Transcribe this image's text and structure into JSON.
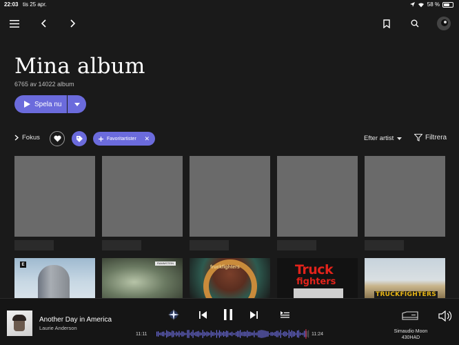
{
  "status": {
    "time": "22:03",
    "date": "tis 25 apr.",
    "battery": "58 %",
    "battery_level": 0.58
  },
  "header": {
    "title": "Mina album",
    "subtitle": "6765 av 14022 album"
  },
  "actions": {
    "play_label": "Spela nu"
  },
  "filters": {
    "focus_label": "Fokus",
    "chip_label": "Favoritartister",
    "sort_label": "Efter artist",
    "filter_label": "Filtrera"
  },
  "albums_row2": [
    {
      "badge": "E"
    },
    {
      "band": "RAMMSTEIN"
    },
    {
      "text": "fruckfighters"
    },
    {
      "title_top": "Truck",
      "title_bottom": "fighters"
    },
    {
      "title": "TRUCKFIGHTERS"
    }
  ],
  "player": {
    "track": "Another Day in America",
    "artist": "Laurie Anderson",
    "elapsed": "11:11",
    "total": "11:24",
    "progress": 0.975,
    "device": "Simaudio Moon",
    "device_sub": "430HAD"
  },
  "colors": {
    "accent": "#6b6bdc",
    "background": "#1a1a1a"
  }
}
